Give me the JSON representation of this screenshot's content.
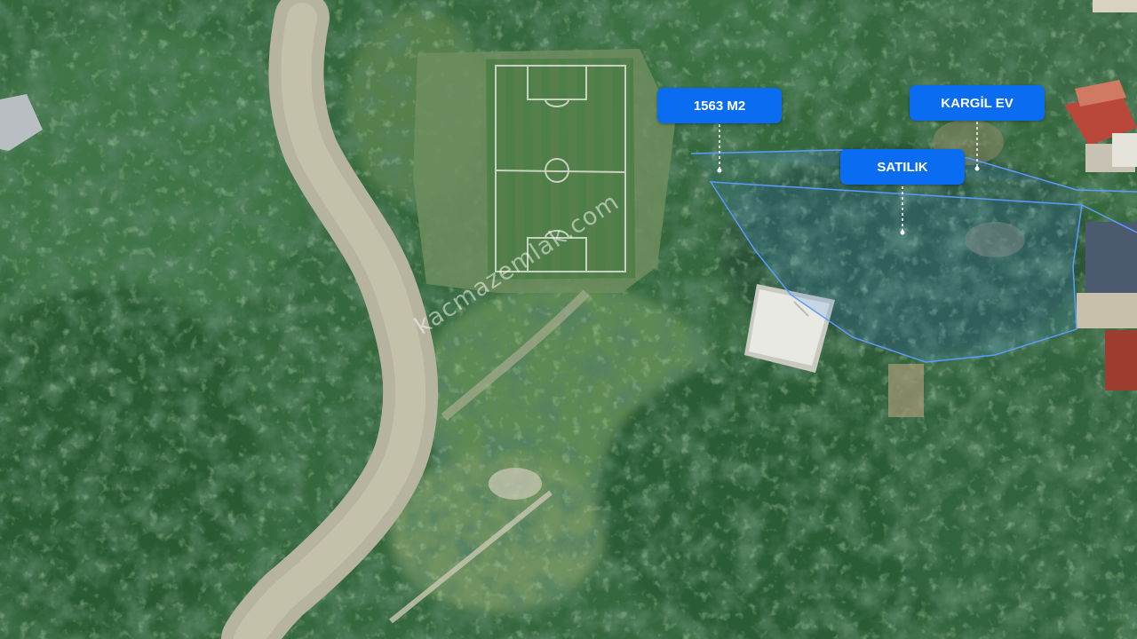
{
  "colors": {
    "label_bg": "#0a6cf0",
    "parcel_stroke": "#5b9cff",
    "parcel_fill": "#4e8fe0"
  },
  "map": {
    "type": "satellite",
    "features": [
      "football-pitch",
      "dirt-road",
      "forest",
      "building-white-roof",
      "building-red-roof",
      "land-parcel"
    ]
  },
  "labels": {
    "area": "1563 M2",
    "for_sale": "SATILIK",
    "masonry_house": "KARGİL EV"
  },
  "watermark": "kacmazemlak.com"
}
